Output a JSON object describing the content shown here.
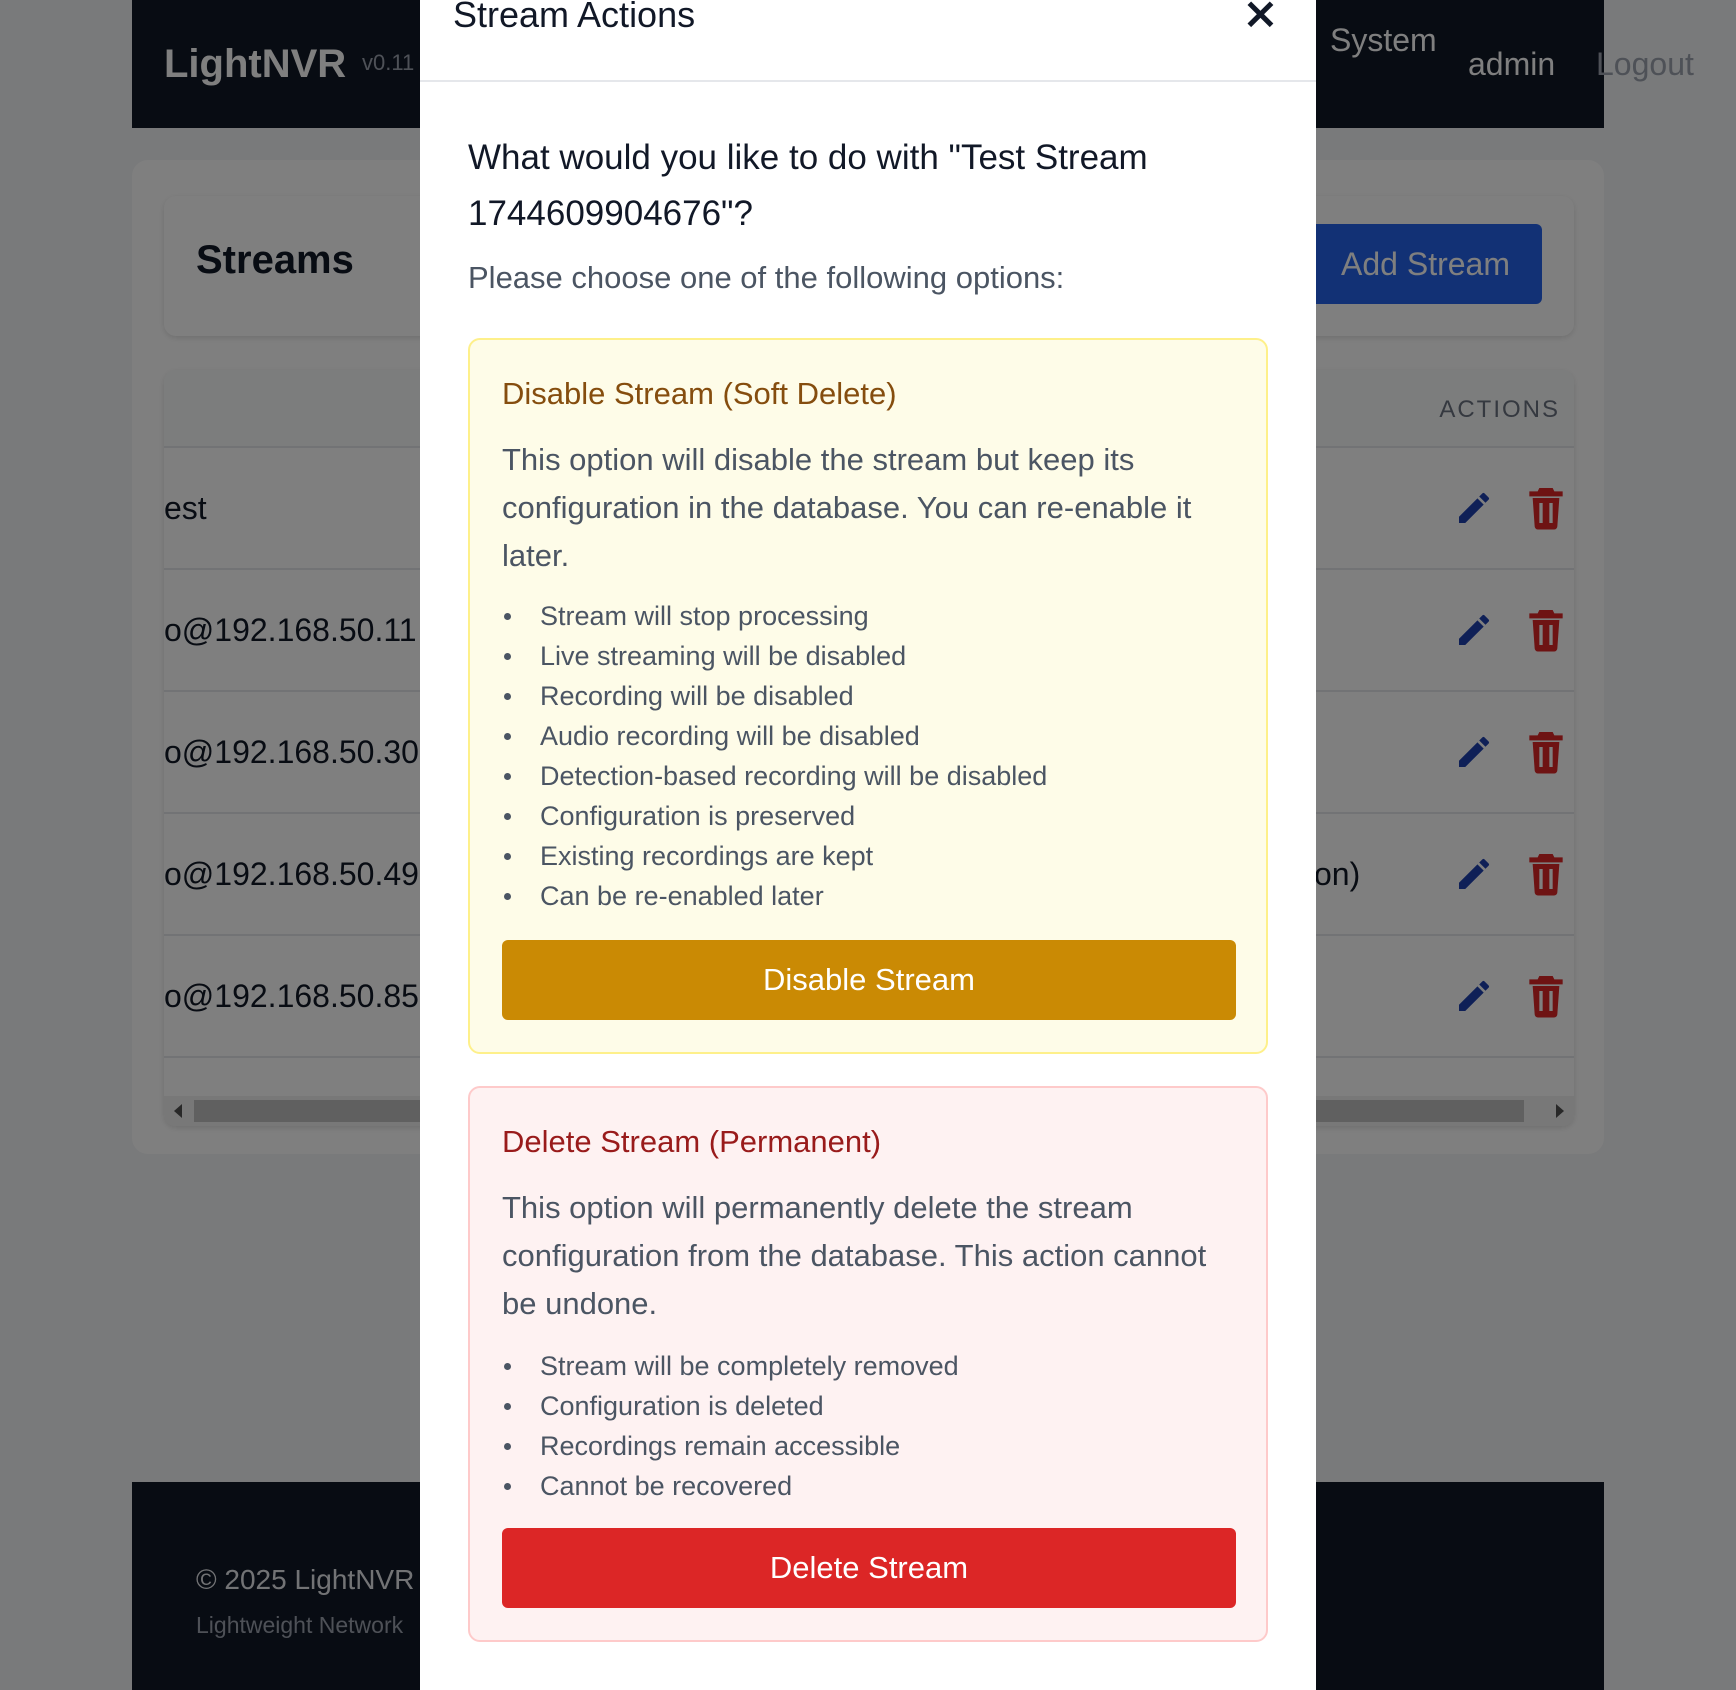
{
  "header": {
    "brand": "LightNVR",
    "version": "v0.11",
    "nav_system": "System",
    "user": "admin",
    "logout": "Logout"
  },
  "streams": {
    "title": "Streams",
    "add_button": "Add Stream",
    "actions_header": "ACTIONS",
    "rows": [
      {
        "url": "est",
        "extra": ""
      },
      {
        "url": "o@192.168.50.11",
        "extra": ""
      },
      {
        "url": "o@192.168.50.30",
        "extra": ""
      },
      {
        "url": "o@192.168.50.49",
        "extra": "on)"
      },
      {
        "url": "o@192.168.50.85",
        "extra": ""
      }
    ]
  },
  "footer": {
    "copyright": "© 2025 LightNVR",
    "tagline": "Lightweight Network"
  },
  "modal": {
    "title": "Stream Actions",
    "close": "×",
    "question": "What would you like to do with \"Test Stream 1744609904676\"?",
    "instruction": "Please choose one of the following options:",
    "disable": {
      "title": "Disable Stream (Soft Delete)",
      "description": "This option will disable the stream but keep its configuration in the database. You can re-enable it later.",
      "bullets": [
        "Stream will stop processing",
        "Live streaming will be disabled",
        "Recording will be disabled",
        "Audio recording will be disabled",
        "Detection-based recording will be disabled",
        "Configuration is preserved",
        "Existing recordings are kept",
        "Can be re-enabled later"
      ],
      "button": "Disable Stream"
    },
    "delete": {
      "title": "Delete Stream (Permanent)",
      "description": "This option will permanently delete the stream configuration from the database. This action cannot be undone.",
      "bullets": [
        "Stream will be completely removed",
        "Configuration is deleted",
        "Recordings remain accessible",
        "Cannot be recovered"
      ],
      "button": "Delete Stream"
    }
  },
  "icons": {
    "edit": "pencil-icon",
    "delete": "trash-icon",
    "close": "close-icon"
  },
  "colors": {
    "header_bg": "#111827",
    "primary": "#2563eb",
    "warning_btn": "#ca8a04",
    "danger_btn": "#dc2626",
    "warning_bg": "#fefce8",
    "danger_bg": "#fef2f2"
  }
}
